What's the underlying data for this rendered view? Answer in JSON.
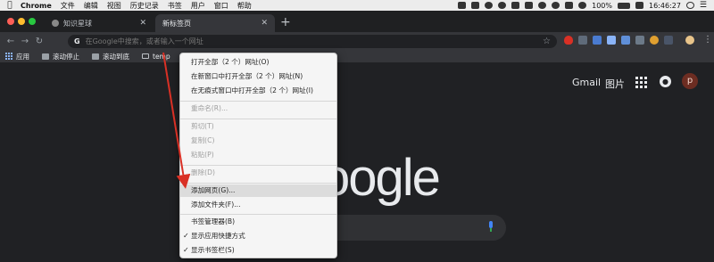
{
  "menubar": {
    "app_name": "Chrome",
    "menus": [
      "文件",
      "编辑",
      "视图",
      "历史记录",
      "书签",
      "用户",
      "窗口",
      "帮助"
    ],
    "battery": "100%",
    "time": "16:46:27"
  },
  "tabs": [
    {
      "title": "知识星球",
      "active": false
    },
    {
      "title": "新标签页",
      "active": true
    }
  ],
  "toolbar": {
    "omnibox_placeholder": "在Google中搜索，或者输入一个网址",
    "omnibox_g": "G"
  },
  "bookmarks": [
    {
      "label": "应用",
      "icon": "apps-grid-icon"
    },
    {
      "label": "滚动停止",
      "icon": "page-icon"
    },
    {
      "label": "滚动到底",
      "icon": "page-icon"
    },
    {
      "label": "temp",
      "icon": "folder-icon"
    }
  ],
  "google_header": {
    "gmail": "Gmail",
    "images": "图片",
    "avatar_letter": "p"
  },
  "logo_text": "oogle",
  "context_menu": {
    "items": [
      {
        "label": "打开全部（2 个）网址(O)",
        "disabled": false
      },
      {
        "label": "在新窗口中打开全部（2 个）网址(N)",
        "disabled": false
      },
      {
        "label": "在无痕式窗口中打开全部（2 个）网址(I)",
        "disabled": false
      },
      {
        "label": "重命名(R)...",
        "disabled": true
      },
      {
        "label": "剪切(T)",
        "disabled": true
      },
      {
        "label": "复制(C)",
        "disabled": true
      },
      {
        "label": "粘贴(P)",
        "disabled": true
      },
      {
        "label": "删除(D)",
        "disabled": true
      },
      {
        "label": "添加网页(G)...",
        "disabled": false,
        "highlighted": true
      },
      {
        "label": "添加文件夹(F)...",
        "disabled": false
      },
      {
        "label": "书签管理器(B)",
        "disabled": false
      },
      {
        "label": "显示应用快捷方式",
        "disabled": false,
        "checked": true
      },
      {
        "label": "显示书签栏(S)",
        "disabled": false,
        "checked": true
      }
    ]
  },
  "colors": {
    "annotation_arrow": "#d93025",
    "avatar_bg": "#6d2d22"
  }
}
